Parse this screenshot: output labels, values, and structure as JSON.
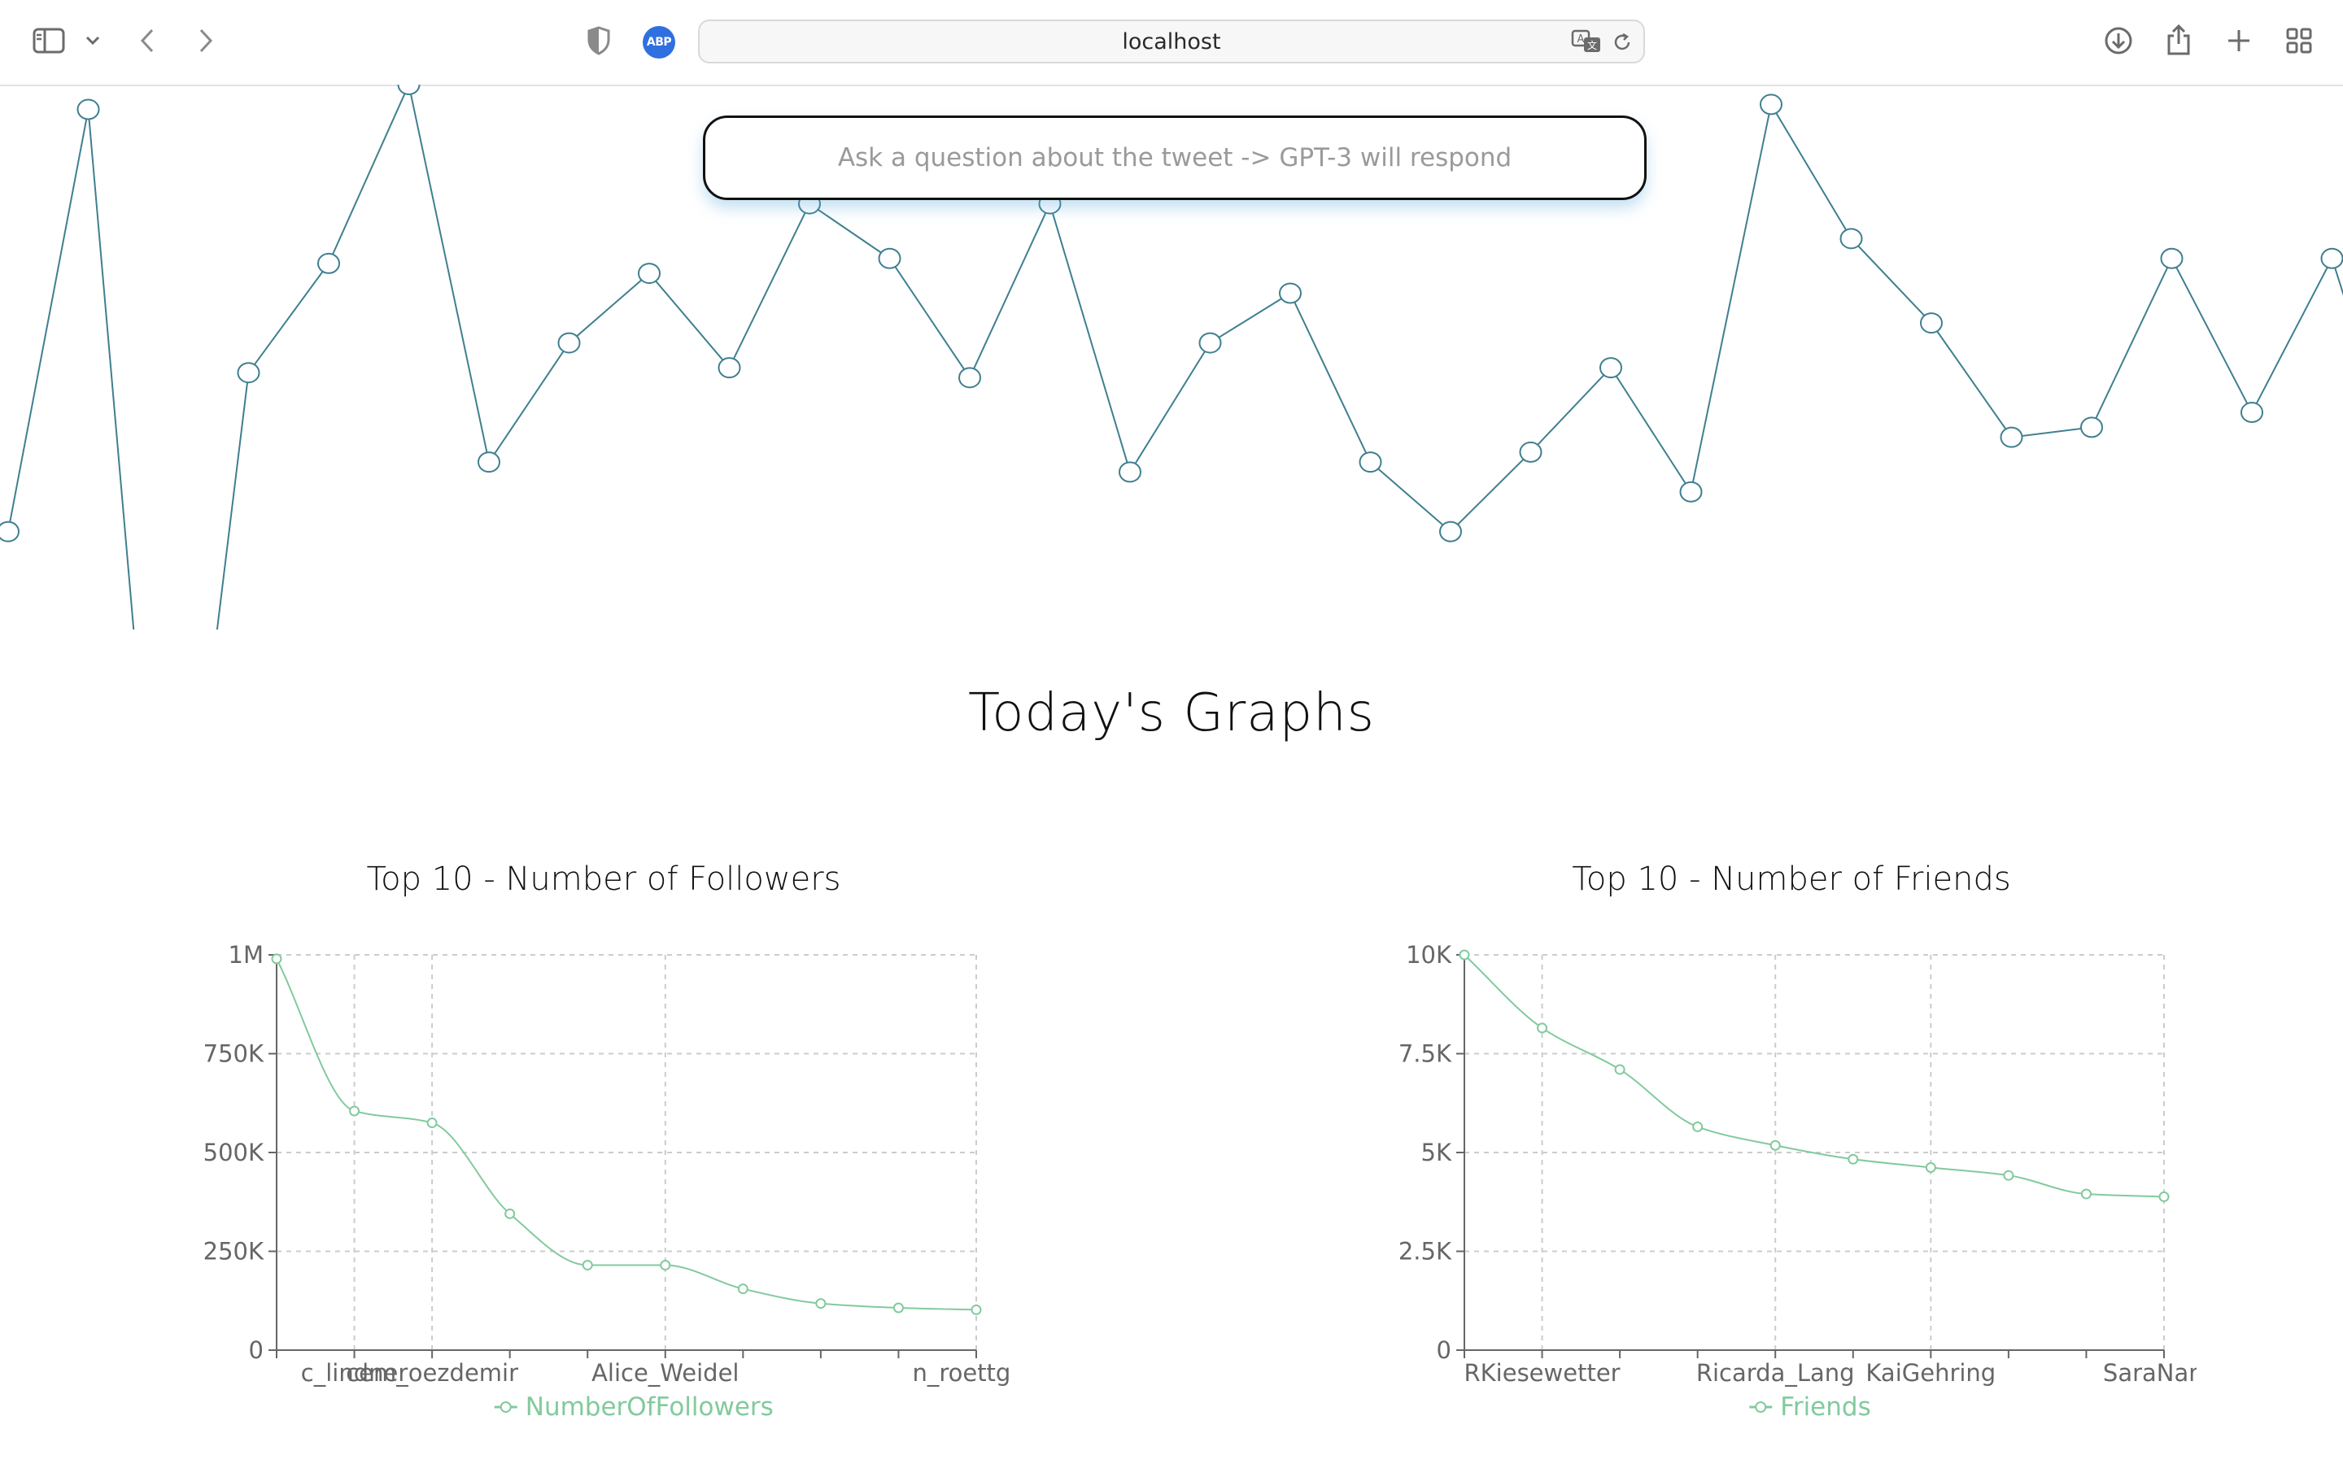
{
  "browser": {
    "url": "localhost",
    "adblock_badge": "ABP",
    "icons": [
      "sidebar-icon",
      "chevron-down-icon",
      "back-icon",
      "forward-icon",
      "shield-icon",
      "translate-icon",
      "reload-icon",
      "download-icon",
      "share-icon",
      "new-tab-icon",
      "tab-overview-icon"
    ]
  },
  "question_box": {
    "placeholder": "Ask a question about the tweet -> GPT-3 will respond"
  },
  "page": {
    "heading": "Today's Graphs"
  },
  "colors": {
    "top_line": "#3f7f8f",
    "series_green": "#82ca9d",
    "grid": "#cccccc",
    "axis": "#666666"
  },
  "chart_data": [
    {
      "type": "line",
      "title": "",
      "xlabel": "",
      "ylabel": "",
      "axes_visible": false,
      "y_direction": "relative",
      "values": [
        0.9,
        0.05,
        1.9,
        0.58,
        0.36,
        0.0,
        0.76,
        0.52,
        0.38,
        0.57,
        0.24,
        0.35,
        0.59,
        0.24,
        0.78,
        0.52,
        0.42,
        0.76,
        0.9,
        0.74,
        0.57,
        0.82,
        0.04,
        0.31,
        0.48,
        0.71,
        0.69,
        0.35,
        0.66,
        0.35,
        0.86
      ]
    },
    {
      "type": "line",
      "title": "Top 10 - Number of Followers",
      "categories": [
        "",
        "c_lindner",
        "cem_oezdemir",
        "",
        "",
        "Alice_Weidel",
        "",
        "",
        "",
        "n_roettgen"
      ],
      "series": [
        {
          "name": "NumberOfFollowers",
          "values": [
            990000,
            605000,
            575000,
            345000,
            215000,
            215000,
            155000,
            118000,
            107000,
            102000
          ]
        }
      ],
      "y_ticks": [
        "0",
        "250K",
        "500K",
        "750K",
        "1M"
      ],
      "ylim": [
        0,
        1000000
      ],
      "grid": true,
      "legend": "bottom-center"
    },
    {
      "type": "line",
      "title": "Top 10 - Number of Friends",
      "categories": [
        "",
        "RKiesewetter",
        "",
        "",
        "Ricarda_Lang",
        "",
        "KaiGehring",
        "",
        "",
        "SaraNanni"
      ],
      "series": [
        {
          "name": "Friends",
          "values": [
            10000,
            8150,
            7100,
            5650,
            5180,
            4830,
            4620,
            4420,
            3950,
            3880
          ]
        }
      ],
      "y_ticks": [
        "0",
        "2.5K",
        "5K",
        "7.5K",
        "10K"
      ],
      "ylim": [
        0,
        10000
      ],
      "grid": true,
      "legend": "bottom-center"
    }
  ]
}
